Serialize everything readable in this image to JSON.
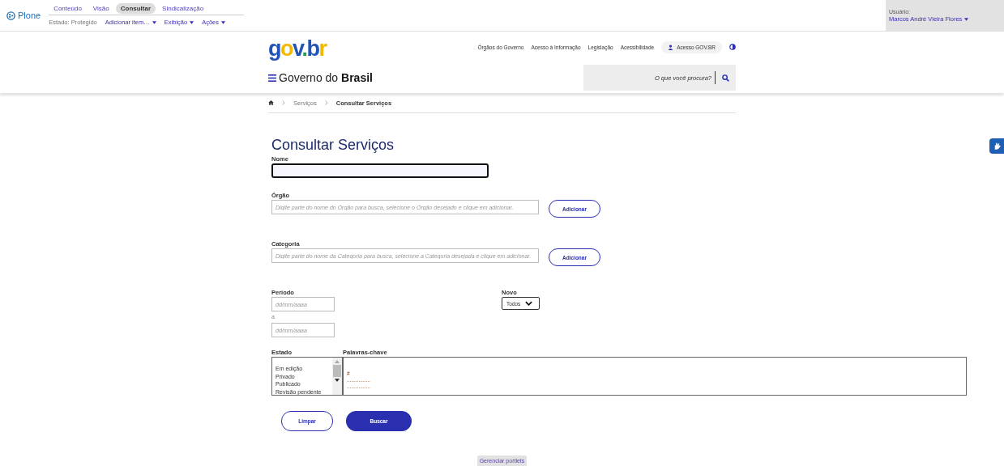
{
  "toolbar": {
    "logo": "Plone",
    "tabs": [
      {
        "label": "Conteúdo",
        "selected": false
      },
      {
        "label": "Visão",
        "selected": false
      },
      {
        "label": "Consultar",
        "selected": true
      },
      {
        "label": "Sindicalização",
        "selected": false
      }
    ],
    "state": "Estado: Protegido",
    "menus": [
      "Adicionar item…",
      "Exibição",
      "Ações"
    ],
    "user_label": "Usuário:",
    "user_name": "Marcos André Vieira Flores"
  },
  "header": {
    "logo": "gov.br",
    "links": [
      "Órgãos do Governo",
      "Acesso à Informação",
      "Legislação",
      "Acessibilidade"
    ],
    "login": "Acesso GOV.BR",
    "site_title_regular": "Governo do",
    "site_title_bold": "Brasil",
    "search": {
      "placeholder": "O que você procura?"
    }
  },
  "breadcrumb": [
    "Serviços",
    "Consultar Serviços"
  ],
  "form": {
    "title": "Consultar Serviços",
    "nome": {
      "label": "Nome"
    },
    "orgao": {
      "label": "Órgão",
      "placeholder": "Digite parte do nome do Órgão para busca, selecione o Órgão desejado e clique em adicionar.",
      "button": "Adicionar"
    },
    "categoria": {
      "label": "Categoria",
      "placeholder": "Digite parte do nome da Categoria para busca, selecione a Categoria desejada e clique em adicionar.",
      "button": "Adicionar"
    },
    "periodo": {
      "label": "Período",
      "from_placeholder": "dd/mm/aaaa",
      "separator": "a",
      "to_placeholder": "dd/mm/aaaa"
    },
    "novo": {
      "label": "Novo",
      "value": "Todos"
    },
    "estado": {
      "label": "Estado",
      "options": [
        "Em edição",
        "Privado",
        "Publicado",
        "Revisão pendente"
      ]
    },
    "palavras": {
      "label": "Palavras-chave",
      "lines": [
        "#",
        "................",
        "................"
      ]
    },
    "buttons": [
      {
        "label": "Limpar",
        "kind": "secondary"
      },
      {
        "label": "Buscar",
        "kind": "primary"
      }
    ]
  },
  "footer": {
    "manage": "Gerenciar portlets"
  }
}
